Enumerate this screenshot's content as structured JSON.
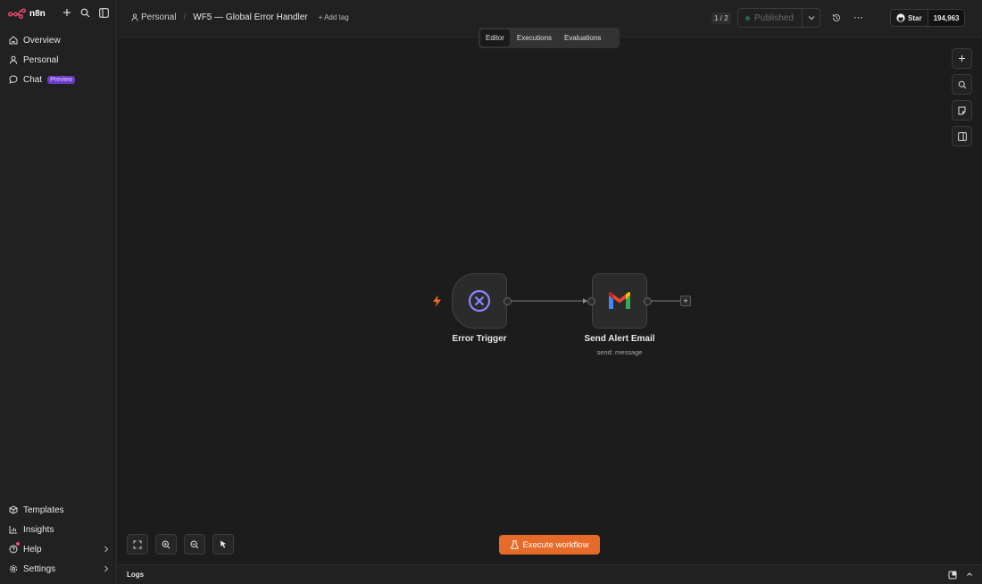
{
  "brand": {
    "name": "n8n",
    "logo_icon": "n8n-logo-icon",
    "accent": "#ea4b71"
  },
  "sidebar": {
    "top_items": [
      {
        "label": "Overview",
        "icon": "home-icon"
      },
      {
        "label": "Personal",
        "icon": "user-icon"
      },
      {
        "label": "Chat",
        "icon": "chat-bubble-icon",
        "badge": "Preview"
      }
    ],
    "bottom_items": [
      {
        "label": "Templates",
        "icon": "box-icon"
      },
      {
        "label": "Insights",
        "icon": "bar-chart-icon"
      },
      {
        "label": "Help",
        "icon": "help-circle-icon"
      },
      {
        "label": "Settings",
        "icon": "gear-icon"
      }
    ]
  },
  "header": {
    "project": "Personal",
    "workflow_title": "WF5 — Global Error Handler",
    "add_tag": "+ Add tag",
    "version": "1 / 2",
    "publish_label": "Published",
    "github_star": "Star",
    "github_count": "194,963"
  },
  "tabs": [
    {
      "label": "Editor",
      "active": true
    },
    {
      "label": "Executions",
      "active": false
    },
    {
      "label": "Evaluations",
      "active": false
    }
  ],
  "nodes": [
    {
      "label": "Error Trigger",
      "icon": "error-x-circle-icon",
      "icon_color": "#8b85ff"
    },
    {
      "label": "Send Alert Email",
      "subtitle": "send: message",
      "icon": "gmail-icon"
    }
  ],
  "execute_button": "Execute workflow",
  "execute_color": "#e66b2a",
  "logs_label": "Logs"
}
